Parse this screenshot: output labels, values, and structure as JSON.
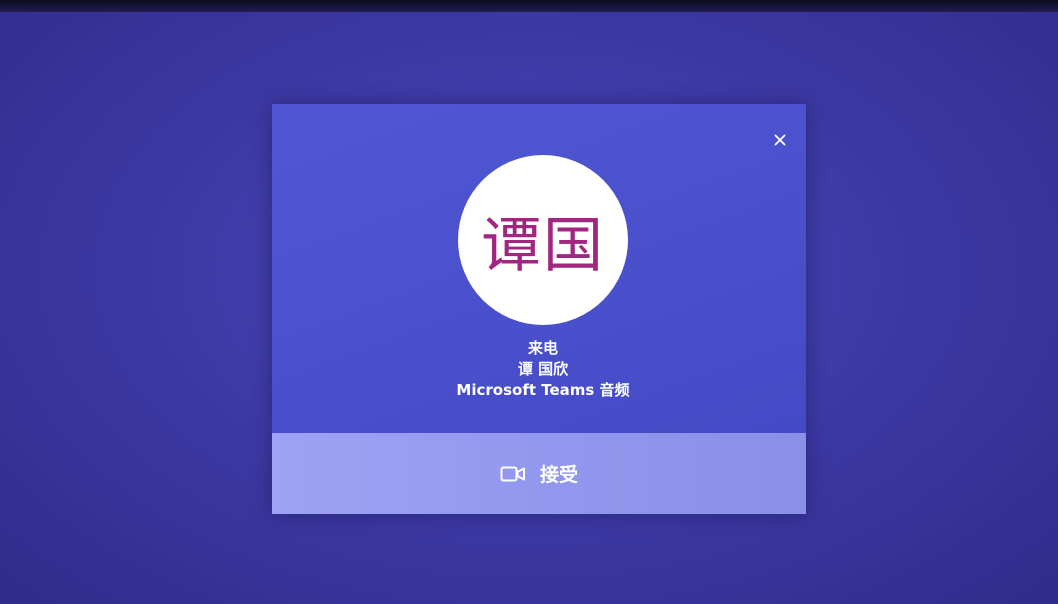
{
  "dialog": {
    "avatar_initials": "谭国",
    "call_status": "来电",
    "caller_name": "谭 国欣",
    "call_type": "Microsoft Teams 音频",
    "accept_label": "接受"
  },
  "colors": {
    "background": "#3e3aa6",
    "dialog": "#4a50cc",
    "accept_bar": "#9298ee",
    "avatar_bg": "#ffffff",
    "avatar_text": "#a2267f"
  },
  "icons": {
    "close": "close-icon",
    "accept": "video-camera-icon"
  }
}
